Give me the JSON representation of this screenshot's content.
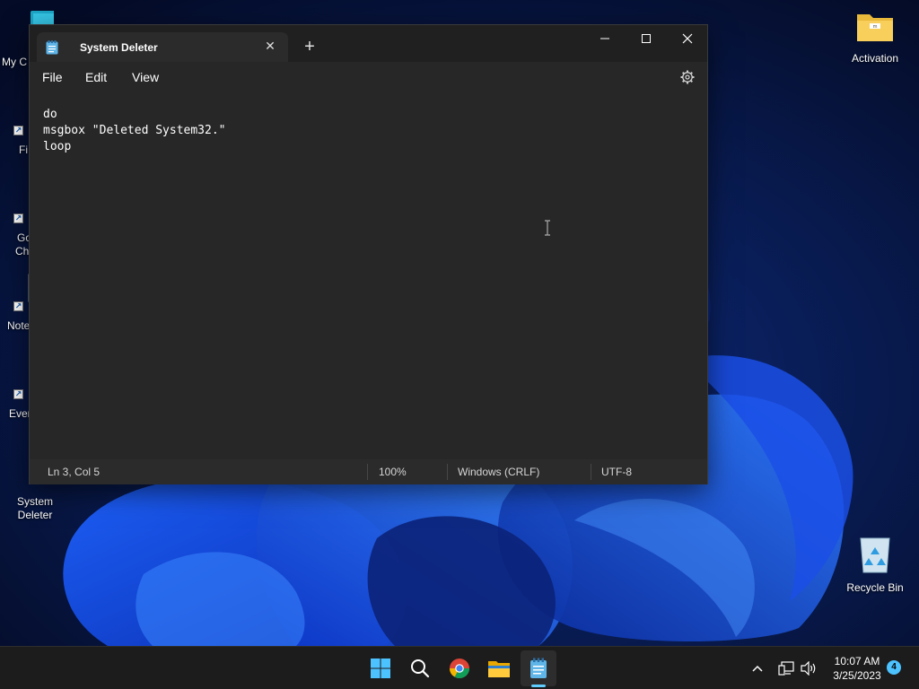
{
  "desktop": {
    "icons": [
      {
        "label": "My Computer",
        "partial_label": "My C"
      },
      {
        "label": "Firefox",
        "partial_label": "Fi"
      },
      {
        "label": "Google Chrome",
        "partial_label_1": "Go",
        "partial_label_2": "Ch"
      },
      {
        "label": "Notepad++",
        "partial_label": "Note"
      },
      {
        "label": "Everything",
        "partial_label": "Ever"
      },
      {
        "label_line1": "System",
        "label_line2": "Deleter"
      },
      {
        "label": "Activation",
        "folder_tag": "m"
      },
      {
        "label": "Recycle Bin"
      }
    ]
  },
  "notepad": {
    "tab_title": "System Deleter",
    "menu": {
      "file": "File",
      "edit": "Edit",
      "view": "View"
    },
    "content_lines": [
      "do",
      "msgbox \"Deleted System32.\"",
      "loop"
    ],
    "status": {
      "position": "Ln 3, Col 5",
      "zoom": "100%",
      "line_ending": "Windows (CRLF)",
      "encoding": "UTF-8"
    }
  },
  "taskbar": {
    "apps": [
      "start-icon",
      "search-icon",
      "chrome-icon",
      "file-explorer-icon",
      "notepad-icon"
    ],
    "active_app": "notepad-icon",
    "clock_time": "10:07 AM",
    "clock_date": "3/25/2023",
    "notification_count": "4"
  },
  "colors": {
    "accent": "#60cdff",
    "window_bg": "#272727",
    "titlebar_bg": "#202020",
    "taskbar_bg": "#1c1c1c"
  }
}
